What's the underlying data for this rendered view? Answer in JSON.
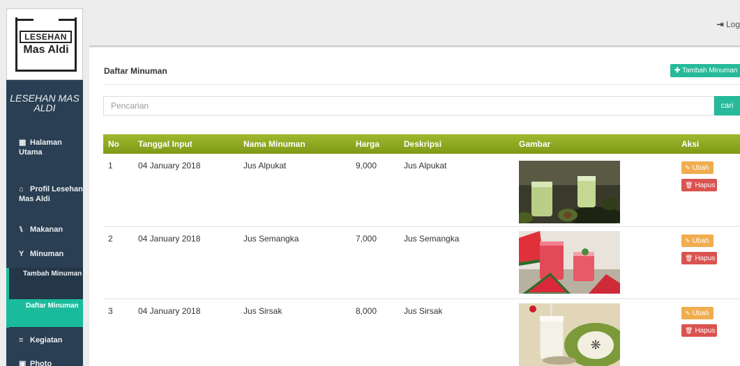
{
  "sidebar": {
    "logo_line1": "LESEHAN",
    "logo_line2": "Mas Aldi",
    "site_title": "LESEHAN MAS ALDI",
    "menu": [
      {
        "label": "Halaman Utama",
        "icon": "grid-icon"
      },
      {
        "label": "Profil Lesehan Mas Aldi",
        "icon": "home-icon"
      },
      {
        "label": "Makanan",
        "icon": "cutlery-icon"
      },
      {
        "label": "Minuman",
        "icon": "glass-icon"
      },
      {
        "label": "Kegiatan",
        "icon": "list-icon"
      },
      {
        "label": "Photo",
        "icon": "picture-icon"
      }
    ],
    "submenu": [
      {
        "label": "Tambah Minuman"
      },
      {
        "label": "Daftar Minuman",
        "active": true
      }
    ]
  },
  "topbar": {
    "logout_label": "Log"
  },
  "panel": {
    "title": "Daftar Minuman",
    "add_button_label": "Tambah Minuman",
    "search_placeholder": "Pencarian",
    "search_button_label": "cari"
  },
  "table": {
    "columns": [
      "No",
      "Tanggal Input",
      "Nama Minuman",
      "Harga",
      "Deskripsi",
      "Gambar",
      "Aksi"
    ],
    "rows": [
      {
        "no": "1",
        "tanggal": "04 January 2018",
        "nama": "Jus Alpukat",
        "harga": "9,000",
        "deskripsi": "Jus Alpukat",
        "ubah": "Ubah",
        "hapus": "Hapus"
      },
      {
        "no": "2",
        "tanggal": "04 January 2018",
        "nama": "Jus Semangka",
        "harga": "7,000",
        "deskripsi": "Jus Semangka",
        "ubah": "Ubah",
        "hapus": "Hapus"
      },
      {
        "no": "3",
        "tanggal": "04 January 2018",
        "nama": "Jus Sirsak",
        "harga": "8,000",
        "deskripsi": "Jus Sirsak",
        "ubah": "Ubah",
        "hapus": "Hapus"
      }
    ]
  },
  "colors": {
    "sidebar_bg": "#2a3f54",
    "accent_green": "#26b99a",
    "header_olive": "#8ea91f",
    "warning": "#f0ad4e",
    "danger": "#d9534f"
  }
}
